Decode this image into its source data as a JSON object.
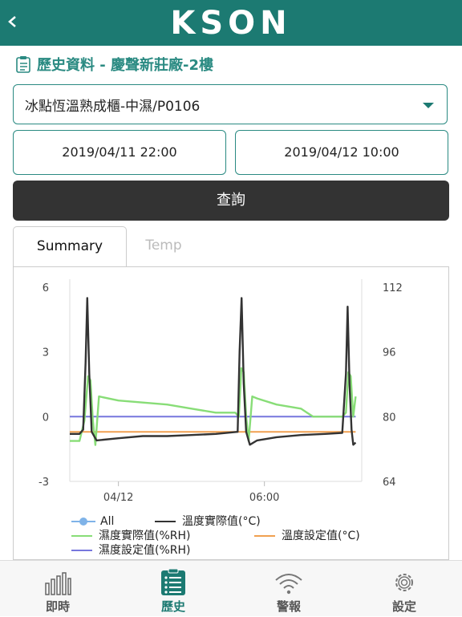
{
  "header": {
    "back_icon": "chevron-left-icon",
    "logo_text": "KSON",
    "bg_color": "#1c7a72"
  },
  "page": {
    "title": "歷史資料 - 慶聲新莊廠-2樓",
    "title_icon": "document-list-icon"
  },
  "device_select": {
    "value": "冰點恆溫熟成櫃-中濕/P0106"
  },
  "date_range": {
    "start": "2019/04/11 22:00",
    "end": "2019/04/12 10:00"
  },
  "query_button": {
    "label": "查詢"
  },
  "tabs": [
    {
      "label": "Summary",
      "active": true
    },
    {
      "label": "Temp",
      "active": false
    }
  ],
  "chart_data": {
    "type": "line",
    "y_left": {
      "ticks": [
        "6",
        "3",
        "0",
        "-3"
      ],
      "range": [
        -3,
        6
      ]
    },
    "y_right": {
      "ticks": [
        "112",
        "96",
        "80",
        "64"
      ],
      "range": [
        64,
        112
      ]
    },
    "x_ticks": [
      "04/12",
      "06:00"
    ],
    "x_range_hours": [
      22,
      34
    ],
    "series": [
      {
        "name": "All",
        "color": "#7fb3e8",
        "values": []
      },
      {
        "name": "溫度實際值(°C)",
        "color": "#333333",
        "axis": "left",
        "x": [
          22.0,
          22.4,
          22.55,
          22.65,
          22.72,
          22.8,
          22.9,
          23.1,
          24,
          25,
          26,
          27,
          28,
          28.9,
          28.98,
          29.06,
          29.15,
          29.25,
          29.4,
          29.7,
          30.5,
          31.5,
          32.5,
          33.2,
          33.35,
          33.42,
          33.5,
          33.58,
          33.65,
          33.75
        ],
        "values": [
          -0.8,
          -0.8,
          -0.6,
          2.5,
          5.5,
          2.0,
          -0.7,
          -1.1,
          -1.0,
          -0.9,
          -0.9,
          -0.85,
          -0.8,
          -0.7,
          3.0,
          5.5,
          1.5,
          -0.7,
          -1.3,
          -1.1,
          -0.95,
          -0.85,
          -0.8,
          -0.75,
          2.0,
          5.1,
          1.5,
          -0.6,
          -1.3,
          -1.2
        ]
      },
      {
        "name": "濕度實際值(%RH)",
        "color": "#88dd77",
        "axis": "right",
        "x": [
          22.0,
          22.4,
          22.6,
          22.75,
          22.85,
          22.95,
          23.05,
          23.2,
          24,
          25,
          26,
          27,
          28,
          28.8,
          28.95,
          29.05,
          29.15,
          29.25,
          29.35,
          29.5,
          29.7,
          30.5,
          31.5,
          32,
          32.5,
          33.2,
          33.35,
          33.45,
          33.55,
          33.65,
          33.75
        ],
        "values": [
          74,
          74,
          79,
          90,
          89,
          79,
          73,
          85,
          84,
          83.5,
          83,
          82,
          81,
          81,
          80,
          92,
          91,
          80,
          74,
          85,
          84.5,
          83,
          82,
          80,
          80,
          80,
          81,
          91,
          90,
          80,
          85
        ]
      },
      {
        "name": "溫度設定值(°C)",
        "color": "#f0a050",
        "axis": "left",
        "x": [
          22,
          33.75
        ],
        "values": [
          -0.7,
          -0.7
        ]
      },
      {
        "name": "濕度設定值(%RH)",
        "color": "#7777dd",
        "axis": "right",
        "x": [
          22,
          33.75
        ],
        "values": [
          80,
          80
        ]
      }
    ]
  },
  "bottom_nav": [
    {
      "label": "即時",
      "icon": "bar-chart-icon",
      "active": false
    },
    {
      "label": "歷史",
      "icon": "list-document-icon",
      "active": true
    },
    {
      "label": "警報",
      "icon": "wifi-signal-icon",
      "active": false
    },
    {
      "label": "設定",
      "icon": "gear-icon",
      "active": false
    }
  ]
}
